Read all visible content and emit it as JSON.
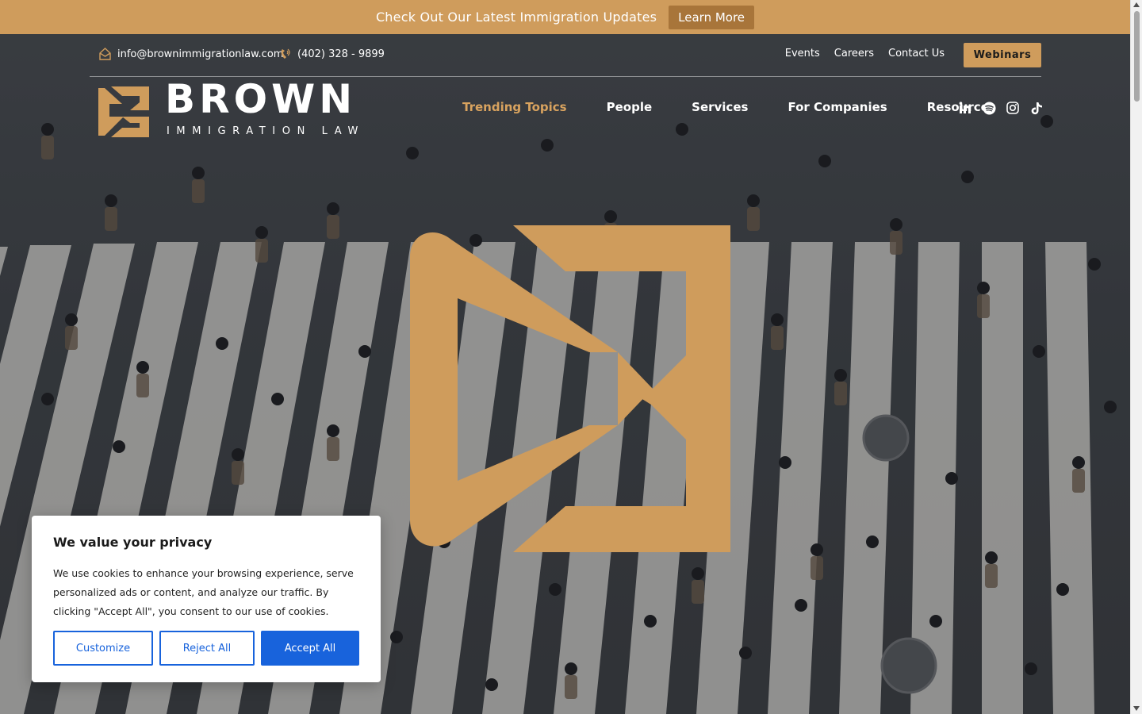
{
  "announcement": {
    "text": "Check Out Our Latest Immigration Updates",
    "button_label": "Learn More"
  },
  "utility": {
    "email": "info@brownimmigrationlaw.com",
    "phone": "(402) 328 - 9899",
    "links": [
      "Events",
      "Careers",
      "Contact Us"
    ],
    "cta_label": "Webinars"
  },
  "logo": {
    "word": "BROWN",
    "sub": "IMMIGRATION LAW"
  },
  "nav": {
    "items": [
      {
        "label": "Trending Topics",
        "active": true
      },
      {
        "label": "People",
        "active": false
      },
      {
        "label": "Services",
        "active": false
      },
      {
        "label": "For Companies",
        "active": false
      },
      {
        "label": "Resources",
        "active": false
      }
    ],
    "socials": [
      "linkedin-icon",
      "spotify-icon",
      "instagram-icon",
      "tiktok-icon"
    ]
  },
  "cookie": {
    "title": "We value your privacy",
    "text": "We use cookies to enhance your browsing experience, serve personalized ads or content, and analyze our traffic. By clicking \"Accept All\", you consent to our use of cookies.",
    "customize_label": "Customize",
    "reject_label": "Reject All",
    "accept_label": "Accept All"
  },
  "colors": {
    "brand_gold": "#cf9c5c",
    "announce_button": "#a8753a",
    "accept_blue": "#1863dc"
  }
}
